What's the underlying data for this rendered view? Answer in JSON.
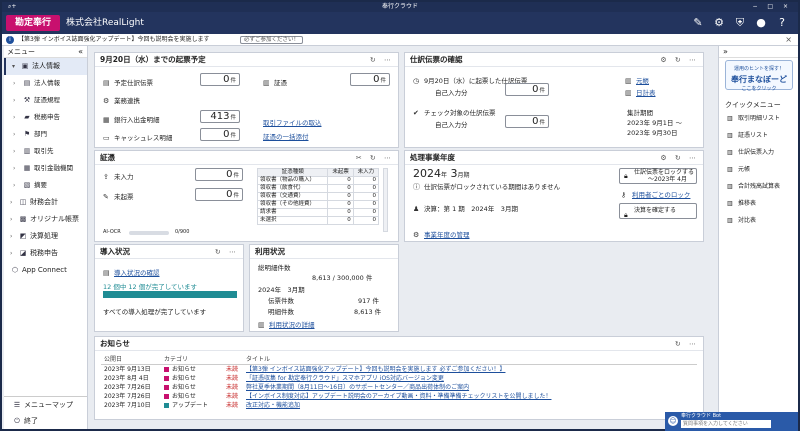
{
  "window": {
    "title": "奉行クラウド",
    "left_icons": "⌕+",
    "right_controls": "− □ ×"
  },
  "app": {
    "logo": "勘定奉行",
    "company": "株式会社RealLight"
  },
  "notice": {
    "text": "【第3弾 インボイス誌面強化アップデート】今回も説明会を実施します",
    "button": "必ずご参加ください！"
  },
  "sidebar": {
    "title": "メニュー",
    "items": [
      {
        "label": "法人情報",
        "type": "top",
        "icon": "▣",
        "active": true
      },
      {
        "label": "法人情報",
        "type": "sub",
        "icon": "▤"
      },
      {
        "label": "証憑規程",
        "type": "sub",
        "icon": "⚒"
      },
      {
        "label": "税務申告",
        "type": "sub",
        "icon": "▰"
      },
      {
        "label": "部門",
        "type": "sub",
        "icon": "⚑"
      },
      {
        "label": "取引先",
        "type": "sub",
        "icon": "▥"
      },
      {
        "label": "取引金融機関",
        "type": "sub",
        "icon": "▦"
      },
      {
        "label": "摘要",
        "type": "sub",
        "icon": "▧"
      },
      {
        "label": "財務会計",
        "type": "top",
        "icon": "◫"
      },
      {
        "label": "オリジナル帳票",
        "type": "top",
        "icon": "▩"
      },
      {
        "label": "決算処理",
        "type": "top",
        "icon": "◩"
      },
      {
        "label": "税務申告",
        "type": "top",
        "icon": "◪"
      },
      {
        "label": "App Connect",
        "type": "top",
        "icon": "⬡"
      }
    ],
    "bottom": [
      {
        "label": "メニューマップ",
        "icon": "☰"
      },
      {
        "label": "終了",
        "icon": "⏻"
      }
    ]
  },
  "kiki": {
    "title": "9月20日（水）までの起票予定",
    "rows": [
      {
        "label": "予定仕訳伝票",
        "value": "0",
        "unit": "件",
        "icon": "▤"
      },
      {
        "label": "業務連携",
        "value": "",
        "unit": "",
        "icon": "⚙"
      },
      {
        "label": "銀行入出金明細",
        "value": "413",
        "unit": "件",
        "icon": "▦"
      },
      {
        "label": "キャッシュレス明細",
        "value": "0",
        "unit": "件",
        "icon": "▭"
      }
    ],
    "shohyo_label": "証憑",
    "shohyo_value": "0",
    "shohyo_unit": "件",
    "link1": "取引ファイルの取込",
    "link2": "証憑の一括添付"
  },
  "shiwake": {
    "title": "仕訳伝票の確認",
    "row1_label": "9月20日（水）に起票した仕訳伝票",
    "row1_sub": "自己入力分",
    "row1_value": "0",
    "row2_label": "チェック対象の仕訳伝票",
    "row2_sub": "自己入力分",
    "row2_value": "0",
    "unit": "件",
    "side_link1": "元帳",
    "side_link2": "日計表",
    "period_label": "集計期間",
    "period_from": "2023年 9月1日 〜",
    "period_to": "2023年 9月30日"
  },
  "shoken": {
    "title": "証憑",
    "rows": [
      {
        "label": "未入力",
        "value": "0",
        "unit": "件"
      },
      {
        "label": "未起票",
        "value": "0",
        "unit": "件"
      }
    ],
    "ocr_label": "AI-OCR",
    "ocr_value": "0/900",
    "table_headers": [
      "証憑種類",
      "未起票",
      "未入力"
    ],
    "table_rows": [
      {
        "name": "領収書（物品の購入）",
        "a": "0",
        "b": "0"
      },
      {
        "name": "領収書（飲食代）",
        "a": "0",
        "b": "0"
      },
      {
        "name": "領収書（交通費）",
        "a": "0",
        "b": "0"
      },
      {
        "name": "領収書（その他経費）",
        "a": "0",
        "b": "0"
      },
      {
        "name": "請求書",
        "a": "0",
        "b": "0"
      },
      {
        "name": "未選択",
        "a": "0",
        "b": "0"
      }
    ]
  },
  "shori": {
    "title": "処理事業年度",
    "year": "2024",
    "year_unit": "年",
    "month": "3",
    "month_unit": "月期",
    "lock_msg": "仕訳伝票がロックされている期間はありません",
    "kessan": "決算：第 1 期　2024年　3月期",
    "btn1": "仕訳伝票をロックする",
    "btn1_sub": "〜2023年 4月",
    "link_lock": "利用者ごとのロック",
    "btn2": "決算を確定する",
    "link_manage": "事業年度の管理"
  },
  "donyu": {
    "title": "導入状況",
    "link": "導入状況の確認",
    "progress_text": "12 個中 12 個が完了しています",
    "progress": 1.0,
    "done_text": "すべての導入処理が完了しています"
  },
  "riyo": {
    "title": "利用状況",
    "total_label": "総明細件数",
    "total_value": "8,613 / 300,000 件",
    "period": "2024年　3月期",
    "r1_label": "伝票件数",
    "r1_value": "917 件",
    "r2_label": "明細件数",
    "r2_value": "8,613 件",
    "link": "利用状況の詳細"
  },
  "news": {
    "title": "お知らせ",
    "headers": [
      "公開日",
      "カテゴリ",
      "タイトル"
    ],
    "rows": [
      {
        "date": "2023年 9月13日",
        "cat": "お知らせ",
        "color": "#c8106e",
        "status": "未読",
        "title": "【第3弾 インボイス誌面強化アップデート】今回も説明会を実施します 必ずご参加ください！】"
      },
      {
        "date": "2023年 8月 4日",
        "cat": "お知らせ",
        "color": "#c8106e",
        "status": "未読",
        "title": "「証憑収集 for 勘定奉行クラウド」スマホアプリ iOS対応バージョン変更"
      },
      {
        "date": "2023年 7月26日",
        "cat": "お知らせ",
        "color": "#c8106e",
        "status": "未読",
        "title": "弊社夏季休業期間（8月11日〜16日）のサポートセンター／商品出荷体制のご案内"
      },
      {
        "date": "2023年 7月26日",
        "cat": "お知らせ",
        "color": "#c8106e",
        "status": "未読",
        "title": "【インボイス制度対応】アップデート説明会のアーカイブ動画・資料・準備準備チェックリストを公開しました！"
      },
      {
        "date": "2023年 7月10日",
        "cat": "アップデート",
        "color": "#1f8c94",
        "status": "未読",
        "title": "改正対応・機能追加"
      }
    ]
  },
  "rightpanel": {
    "banner_top": "運用のヒントを探す！",
    "banner_main": "奉行まなぼーど",
    "banner_sub": "ここをクリック",
    "title": "クイックメニュー",
    "items": [
      "取引明細リスト",
      "証憑リスト",
      "仕訳伝票入力",
      "元帳",
      "合計残高試算表",
      "推移表",
      "対比表"
    ]
  },
  "chat": {
    "title": "奉行クラウド Bot",
    "placeholder": "質問事項を入力してください"
  }
}
